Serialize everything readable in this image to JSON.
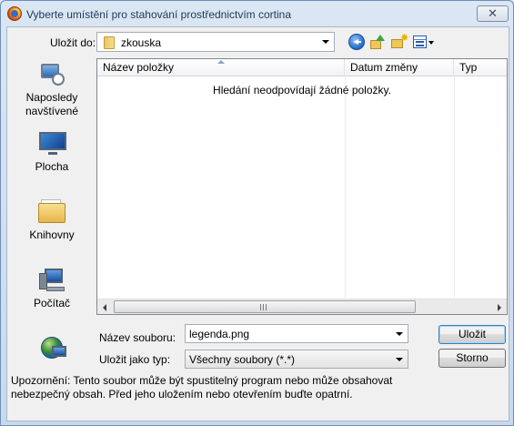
{
  "window": {
    "title": "Vyberte umístění pro stahování prostřednictvím cortina",
    "close_glyph": "✕"
  },
  "toolbar": {
    "save_in_label": "Uložit do:",
    "save_in_value": "zkouska",
    "icons": [
      "back-icon",
      "up-folder-icon",
      "new-folder-icon",
      "view-menu-icon"
    ]
  },
  "places": [
    {
      "label": "Naposledy navštívené",
      "icon": "recent-places-icon"
    },
    {
      "label": "Plocha",
      "icon": "desktop-icon"
    },
    {
      "label": "Knihovny",
      "icon": "libraries-icon"
    },
    {
      "label": "Počítač",
      "icon": "computer-icon"
    },
    {
      "label": "",
      "icon": "network-icon"
    }
  ],
  "filelist": {
    "columns": [
      "Název položky",
      "Datum změny",
      "Typ"
    ],
    "empty_message": "Hledání neodpovídají žádné položky.",
    "scroll_grip": "III"
  },
  "form": {
    "filename_label": "Název souboru:",
    "filename_value": "legenda.png",
    "filetype_label": "Uložit jako typ:",
    "filetype_value": "Všechny soubory (*.*)"
  },
  "buttons": {
    "save": "Uložit",
    "cancel": "Storno"
  },
  "warning": "Upozornění: Tento soubor může být spustitelný program nebo může obsahovat nebezpečný obsah. Před jeho uložením nebo otevřením buďte opatrní.",
  "colors": {
    "title_text": "#1e395b",
    "frame": "#c9d9ec",
    "default_button_border": "#3c7fb1"
  }
}
